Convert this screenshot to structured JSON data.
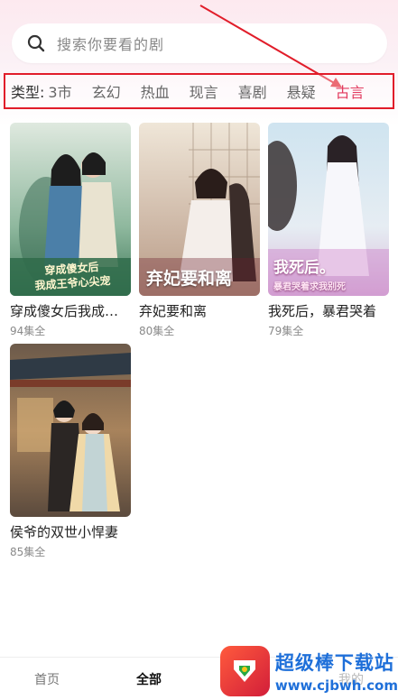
{
  "search": {
    "placeholder": "搜索你要看的剧"
  },
  "categories": {
    "label": "类型:",
    "items": [
      "都市",
      "玄幻",
      "热血",
      "现言",
      "喜剧",
      "悬疑",
      "古言"
    ],
    "first_visible_fragment": "3市",
    "active": "古言",
    "active_color": "#e23a5e",
    "highlight_border_color": "#e11d2a"
  },
  "dramas": [
    {
      "title": "穿成傻女后我成王爷心尖宠",
      "episodes": "94集全",
      "poster_text": [
        "穿成傻女后",
        "我成王爷心尖宠"
      ]
    },
    {
      "title": "弃妃要和离",
      "episodes": "80集全",
      "poster_text": [
        "弃妃要和离"
      ]
    },
    {
      "title": "我死后，暴君哭着",
      "episodes": "79集全",
      "poster_text": [
        "我死后。",
        "暴君哭着求我别死"
      ]
    },
    {
      "title": "侯爷的双世小悍妻",
      "episodes": "85集全",
      "poster_text": []
    }
  ],
  "bottom_nav": {
    "home": "首页",
    "all": "全部",
    "mine": "我的"
  },
  "watermark": {
    "name": "超级棒下载站",
    "url": "www.cjbwh.com"
  }
}
